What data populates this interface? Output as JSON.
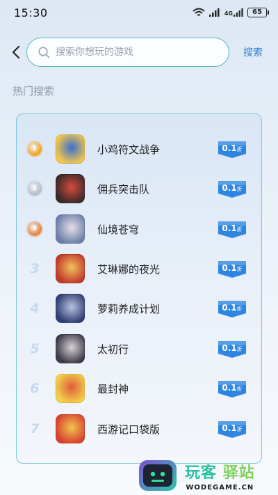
{
  "status_bar": {
    "time": "15:30",
    "network_label": "4G",
    "battery": "65",
    "icons": [
      "wifi-icon",
      "signal-icon",
      "signal-4g-icon",
      "battery-icon"
    ]
  },
  "search": {
    "placeholder": "搜索你想玩的游戏",
    "value": "",
    "action_label": "搜索"
  },
  "hot_search": {
    "title": "热门搜索",
    "items": [
      {
        "rank": "1",
        "medal": "gold",
        "name": "小鸡符文战争",
        "discount_value": "0.1",
        "discount_unit": "折",
        "icon_colors": [
          "#f3c64a",
          "#3a6fd0"
        ]
      },
      {
        "rank": "2",
        "medal": "silver",
        "name": "佣兵突击队",
        "discount_value": "0.1",
        "discount_unit": "折",
        "icon_colors": [
          "#3b2a2a",
          "#d64b3a"
        ]
      },
      {
        "rank": "3",
        "medal": "bronze",
        "name": "仙境苍穹",
        "discount_value": "0.1",
        "discount_unit": "折",
        "icon_colors": [
          "#6b7fa8",
          "#e6dfe7"
        ]
      },
      {
        "rank": "3",
        "medal": "none",
        "name": "艾琳娜的夜光",
        "discount_value": "0.1",
        "discount_unit": "折",
        "icon_colors": [
          "#c0392b",
          "#f1c15a"
        ]
      },
      {
        "rank": "4",
        "medal": "none",
        "name": "萝莉养成计划",
        "discount_value": "0.1",
        "discount_unit": "折",
        "icon_colors": [
          "#2f3e73",
          "#b9c2e0"
        ]
      },
      {
        "rank": "5",
        "medal": "none",
        "name": "太初行",
        "discount_value": "0.1",
        "discount_unit": "折",
        "icon_colors": [
          "#3d3b47",
          "#d9d2d6"
        ]
      },
      {
        "rank": "6",
        "medal": "none",
        "name": "最封神",
        "discount_value": "0.1",
        "discount_unit": "折",
        "icon_colors": [
          "#f2d14a",
          "#e05c3a"
        ]
      },
      {
        "rank": "7",
        "medal": "none",
        "name": "西游记口袋版",
        "discount_value": "0.1",
        "discount_unit": "折",
        "icon_colors": [
          "#d7412f",
          "#f3c44d"
        ]
      }
    ]
  },
  "watermark": {
    "cn_part1": "玩客",
    "cn_part2": "驿站",
    "en": "WODEGAME.CN"
  },
  "colors": {
    "accent": "#2a7fd4",
    "search_border": "#4fb8cf",
    "badge_blue": "#2f86e0",
    "gold": "#f0a92a",
    "silver": "#b9bfc8",
    "bronze": "#e38a4a"
  }
}
